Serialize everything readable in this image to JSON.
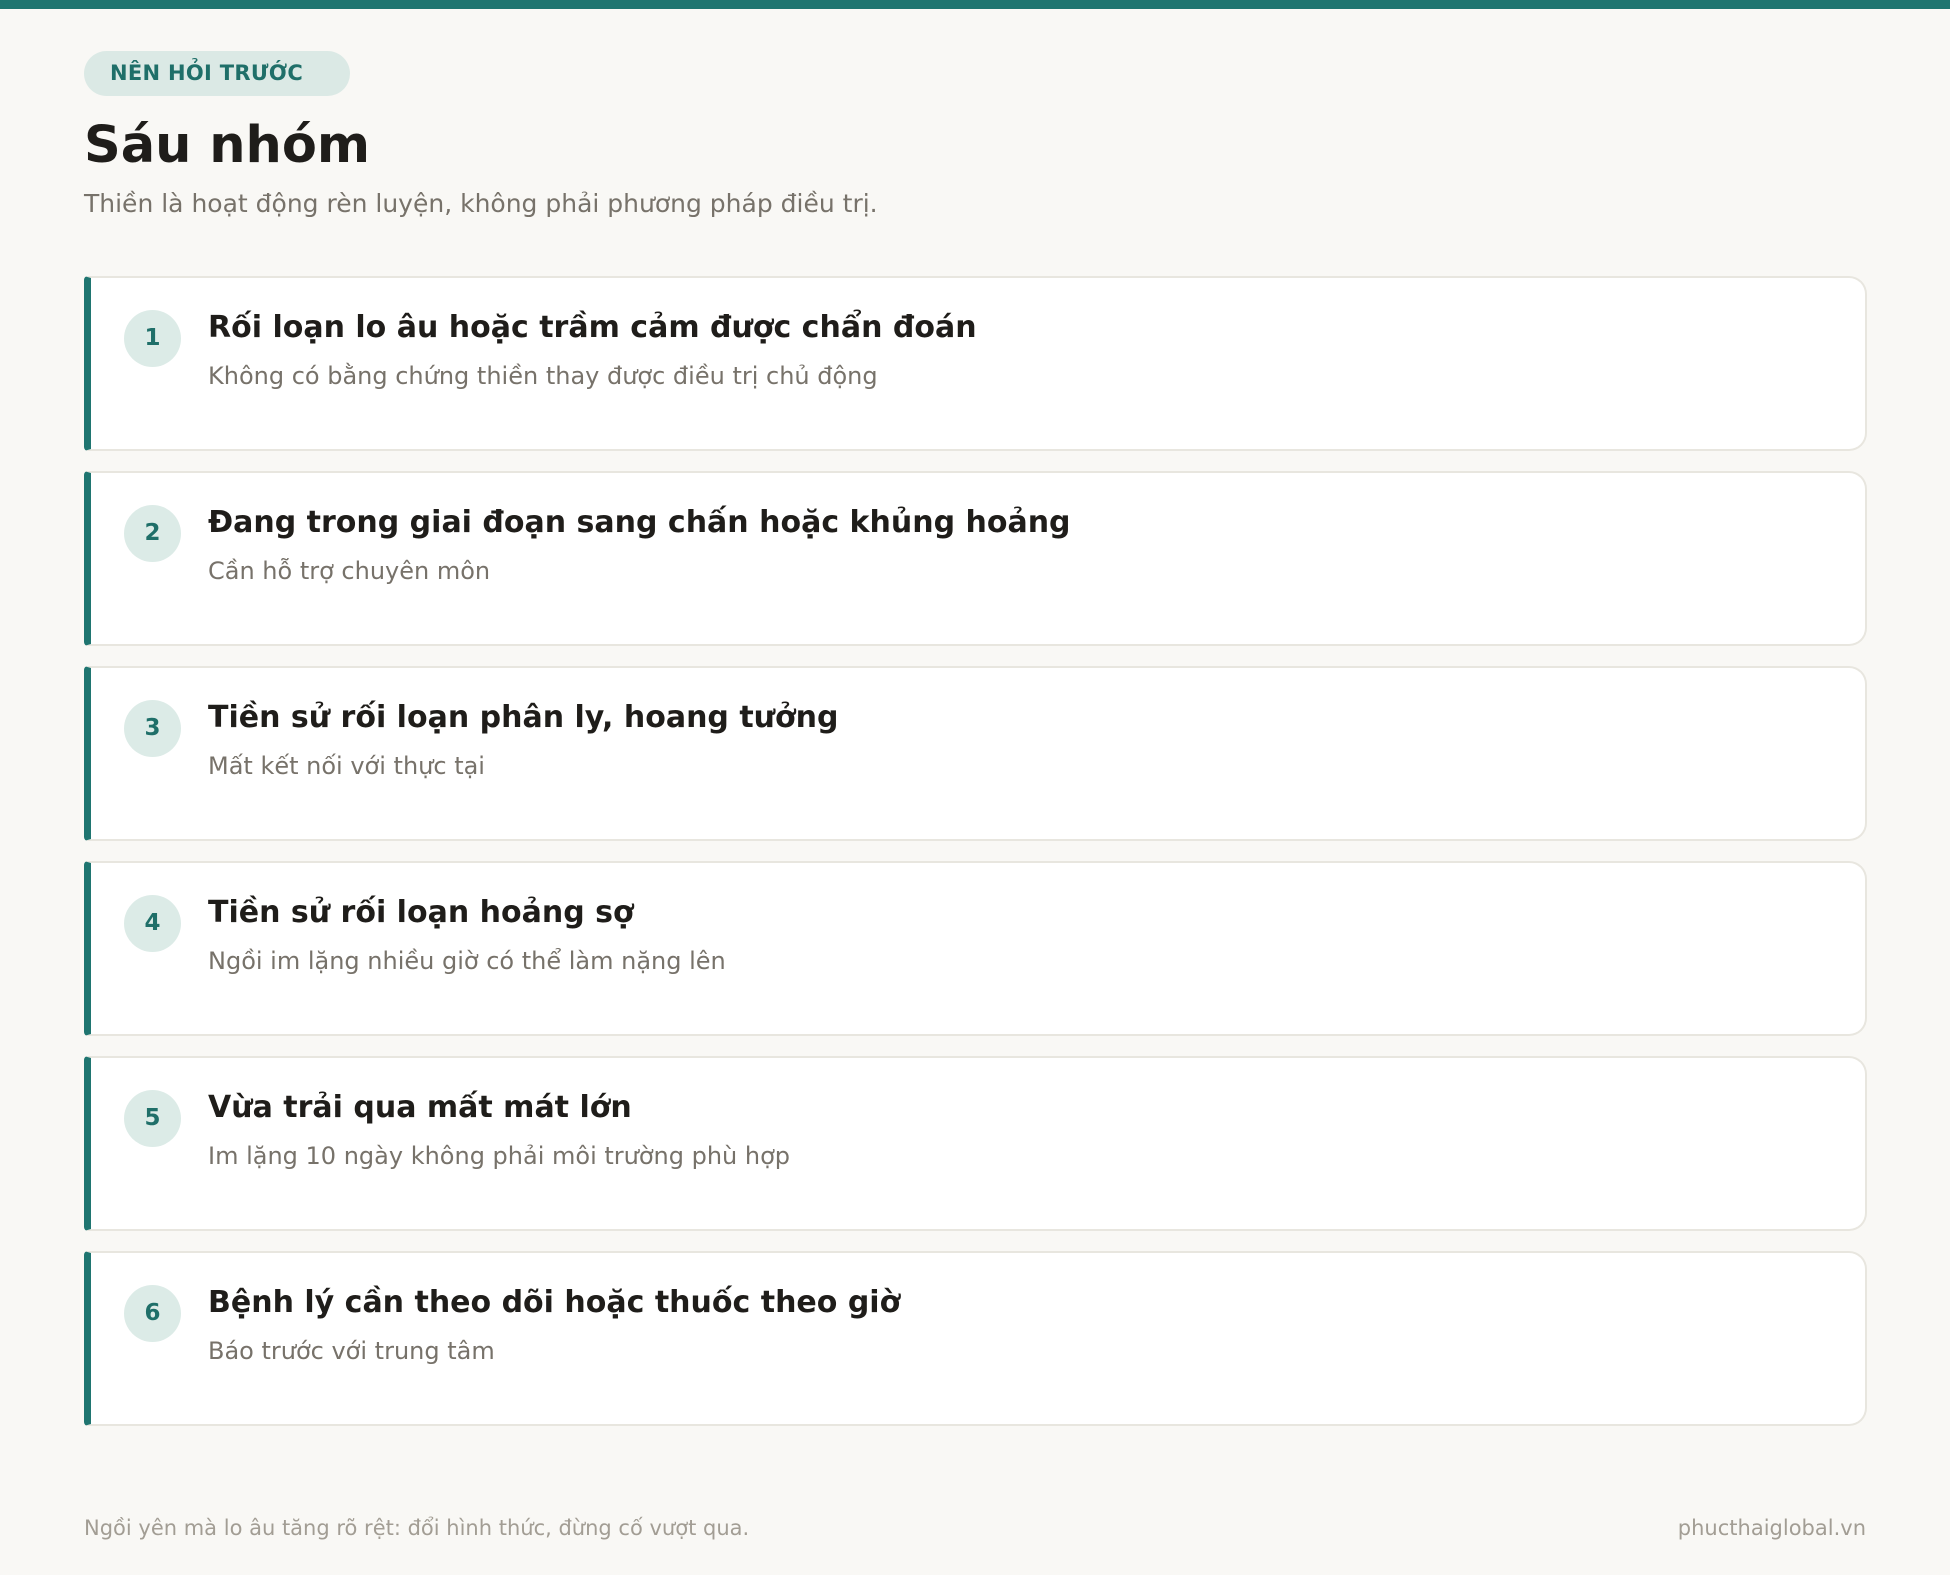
{
  "header": {
    "badge": "NÊN HỎI TRƯỚC",
    "title": "Sáu nhóm",
    "subtitle": "Thiền là hoạt động rèn luyện, không phải phương pháp điều trị."
  },
  "items": [
    {
      "number": "1",
      "title": "Rối loạn lo âu hoặc trầm cảm được chẩn đoán",
      "desc": "Không có bằng chứng thiền thay được điều trị chủ động"
    },
    {
      "number": "2",
      "title": "Đang trong giai đoạn sang chấn hoặc khủng hoảng",
      "desc": "Cần hỗ trợ chuyên môn"
    },
    {
      "number": "3",
      "title": "Tiền sử rối loạn phân ly, hoang tưởng",
      "desc": "Mất kết nối với thực tại"
    },
    {
      "number": "4",
      "title": "Tiền sử rối loạn hoảng sợ",
      "desc": "Ngồi im lặng nhiều giờ có thể làm nặng lên"
    },
    {
      "number": "5",
      "title": "Vừa trải qua mất mát lớn",
      "desc": "Im lặng 10 ngày không phải môi trường phù hợp"
    },
    {
      "number": "6",
      "title": "Bệnh lý cần theo dõi hoặc thuốc theo giờ",
      "desc": "Báo trước với trung tâm"
    }
  ],
  "footer": {
    "note": "Ngồi yên mà lo âu tăng rõ rệt: đổi hình thức, đừng cố vượt qua.",
    "site": "phucthaiglobal.vn"
  },
  "colors": {
    "accent": "#1f7570",
    "badge_bg": "#dbe9e5",
    "background": "#f9f8f5"
  }
}
